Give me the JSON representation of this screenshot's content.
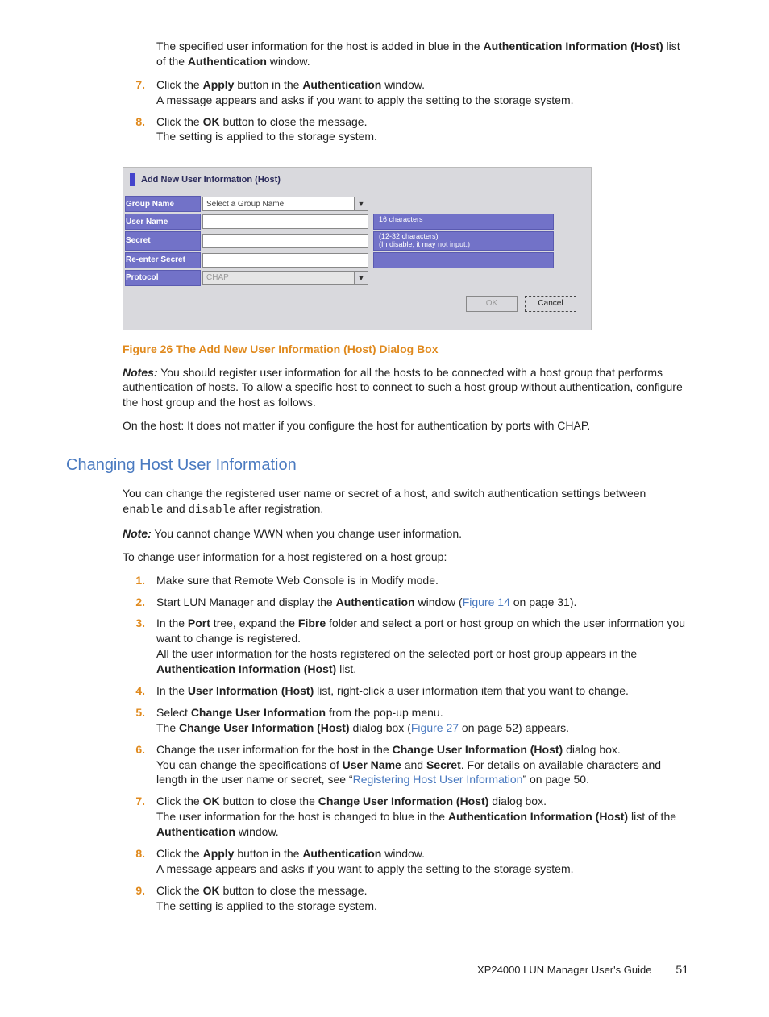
{
  "top_para": {
    "before_bold1": "The specified user information for the host is added in blue in the ",
    "bold1": "Authentication Information (Host)",
    "mid": " list of the ",
    "bold2": "Authentication",
    "after": " window."
  },
  "top_list": [
    {
      "num": "7.",
      "l1a": "Click the ",
      "l1b": "Apply",
      "l1c": " button in the ",
      "l1d": "Authentication",
      "l1e": " window.",
      "l2": "A message appears and asks if you want to apply the setting to the storage system."
    },
    {
      "num": "8.",
      "l1a": "Click the ",
      "l1b": "OK",
      "l1c": " button to close the message.",
      "l2": "The setting is applied to the storage system."
    }
  ],
  "dialog": {
    "title": "Add New User Information (Host)",
    "rows": {
      "group_name": {
        "label": "Group Name",
        "value": "Select a Group Name"
      },
      "user_name": {
        "label": "User Name",
        "hint": "16 characters"
      },
      "secret": {
        "label": "Secret",
        "hint": "(12-32 characters)\n(In disable, it may not input.)"
      },
      "reenter": {
        "label": "Re-enter Secret"
      },
      "protocol": {
        "label": "Protocol",
        "value": "CHAP"
      }
    },
    "buttons": {
      "ok": "OK",
      "cancel": "Cancel"
    }
  },
  "fig_caption": "Figure 26 The Add New User Information (Host) Dialog Box",
  "notes1": {
    "label": "Notes:",
    "text": " You should register user information for all the hosts to be connected with a host group that performs authentication of hosts. To allow a specific host to connect to such a host group without authentication, configure the host group and the host as follows."
  },
  "para_onhost": "On the host: It does not matter if you configure the host for authentication by ports with CHAP.",
  "section_title": "Changing Host User Information",
  "para_change1a": "You can change the registered user name or secret of a host, and switch authentication settings between ",
  "para_change1_code1": "enable",
  "para_change1_mid": " and ",
  "para_change1_code2": "disable",
  "para_change1b": " after registration.",
  "note2": {
    "label": "Note:",
    "text": " You cannot change WWN when you change user information."
  },
  "para_tochange": "To change user information for a host registered on a host group:",
  "list2": [
    {
      "num": "1.",
      "html": "Make sure that Remote Web Console is in Modify mode."
    },
    {
      "num": "2.",
      "pre": "Start LUN Manager and display the ",
      "b1": "Authentication",
      "mid": " window (",
      "link": "Figure 14",
      "post": " on page 31)."
    },
    {
      "num": "3.",
      "l1a": "In the ",
      "l1b": "Port",
      "l1c": " tree, expand the ",
      "l1d": "Fibre",
      "l1e": " folder and select a port or host group on which the user information you want to change is registered.",
      "l2a": "All the user information for the hosts registered on the selected port or host group appears in the ",
      "l2b": "Authentication Information (Host)",
      "l2c": " list."
    },
    {
      "num": "4.",
      "a": "In the ",
      "b": "User Information (Host)",
      "c": " list, right-click a user information item that you want to change."
    },
    {
      "num": "5.",
      "l1a": "Select ",
      "l1b": "Change User Information",
      "l1c": " from the pop-up menu.",
      "l2a": "The ",
      "l2b": "Change User Information (Host)",
      "l2c": " dialog box (",
      "l2link": "Figure 27",
      "l2d": " on page 52) appears."
    },
    {
      "num": "6.",
      "l1a": "Change the user information for the host in the ",
      "l1b": "Change User Information (Host)",
      "l1c": " dialog box.",
      "l2a": "You can change the specifications of ",
      "l2b": "User Name",
      "l2c": " and ",
      "l2d": "Secret",
      "l2e": ". For details on available characters and length in the user name or secret, see “",
      "l2link": "Registering Host User Information",
      "l2f": "” on page 50."
    },
    {
      "num": "7.",
      "l1a": "Click the ",
      "l1b": "OK",
      "l1c": " button to close the ",
      "l1d": "Change User Information (Host)",
      "l1e": " dialog box.",
      "l2a": "The user information for the host is changed to blue in the ",
      "l2b": "Authentication Information (Host)",
      "l2c": " list of the ",
      "l2d": "Authentication",
      "l2e": " window."
    },
    {
      "num": "8.",
      "l1a": "Click the ",
      "l1b": "Apply",
      "l1c": " button in the ",
      "l1d": "Authentication",
      "l1e": " window.",
      "l2": "A message appears and asks if you want to apply the setting to the storage system."
    },
    {
      "num": "9.",
      "l1a": "Click the ",
      "l1b": "OK",
      "l1c": " button to close the message.",
      "l2": "The setting is applied to the storage system."
    }
  ],
  "footer": {
    "doc": "XP24000 LUN Manager User's Guide",
    "page": "51"
  }
}
